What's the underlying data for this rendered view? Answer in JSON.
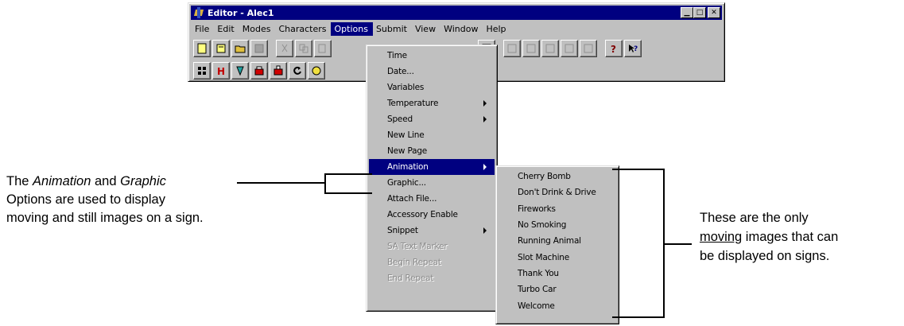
{
  "window": {
    "title": "Editor - Alec1",
    "buttons": {
      "minimize": "▁",
      "maximize": "□",
      "close": "✕"
    }
  },
  "menubar": [
    {
      "label": "File"
    },
    {
      "label": "Edit"
    },
    {
      "label": "Modes"
    },
    {
      "label": "Characters"
    },
    {
      "label": "Options",
      "active": true
    },
    {
      "label": "Submit"
    },
    {
      "label": "View"
    },
    {
      "label": "Window"
    },
    {
      "label": "Help"
    }
  ],
  "options_menu": [
    {
      "label": "Time"
    },
    {
      "label": "Date..."
    },
    {
      "label": "Variables"
    },
    {
      "label": "Temperature",
      "submenu": true
    },
    {
      "label": "Speed",
      "submenu": true
    },
    {
      "label": "New Line"
    },
    {
      "label": "New Page"
    },
    {
      "label": "Animation",
      "submenu": true,
      "highlight": true
    },
    {
      "label": "Graphic..."
    },
    {
      "label": "Attach File..."
    },
    {
      "label": "Accessory Enable"
    },
    {
      "label": "Snippet",
      "submenu": true
    },
    {
      "label": "SA Text Marker",
      "disabled": true
    },
    {
      "label": "Begin Repeat",
      "disabled": true
    },
    {
      "label": "End Repeat",
      "disabled": true
    }
  ],
  "animation_menu": [
    {
      "label": "Cherry Bomb"
    },
    {
      "label": "Don't Drink & Drive"
    },
    {
      "label": "Fireworks"
    },
    {
      "label": "No Smoking"
    },
    {
      "label": "Running Animal"
    },
    {
      "label": "Slot Machine"
    },
    {
      "label": "Thank You"
    },
    {
      "label": "Turbo Car"
    },
    {
      "label": "Welcome"
    }
  ],
  "toolbar_icons": {
    "row1": [
      "new-document-icon",
      "open-folder-icon",
      "open-file-icon",
      "save-icon",
      "cut-icon",
      "copy-icon",
      "paste-icon",
      "frame-icon",
      "send-1-icon",
      "send-2-icon",
      "send-3-icon",
      "send-4-icon",
      "send-5-icon",
      "help-icon",
      "context-help-icon"
    ],
    "row2": [
      "grid-icon",
      "h-icon",
      "color-icon",
      "red-box-icon",
      "red-box-2-icon",
      "rotate-icon",
      "spin-icon",
      "pencil-red-icon",
      "pencil-green-icon",
      "pencil-yellow-icon"
    ]
  },
  "callouts": {
    "left": {
      "line1_pre": "The ",
      "line1_em1": "Animation",
      "line1_mid": " and ",
      "line1_em2": "Graphic",
      "line2": "Options are used to display",
      "line3": "moving and still images on a sign."
    },
    "right": {
      "line1": "These are the only",
      "line2_u": "moving",
      "line2_rest": " images that can",
      "line3": "be displayed on signs."
    }
  },
  "colors": {
    "titlebar": "#000080",
    "menu_bg": "#c0c0c0",
    "highlight": "#000080"
  }
}
